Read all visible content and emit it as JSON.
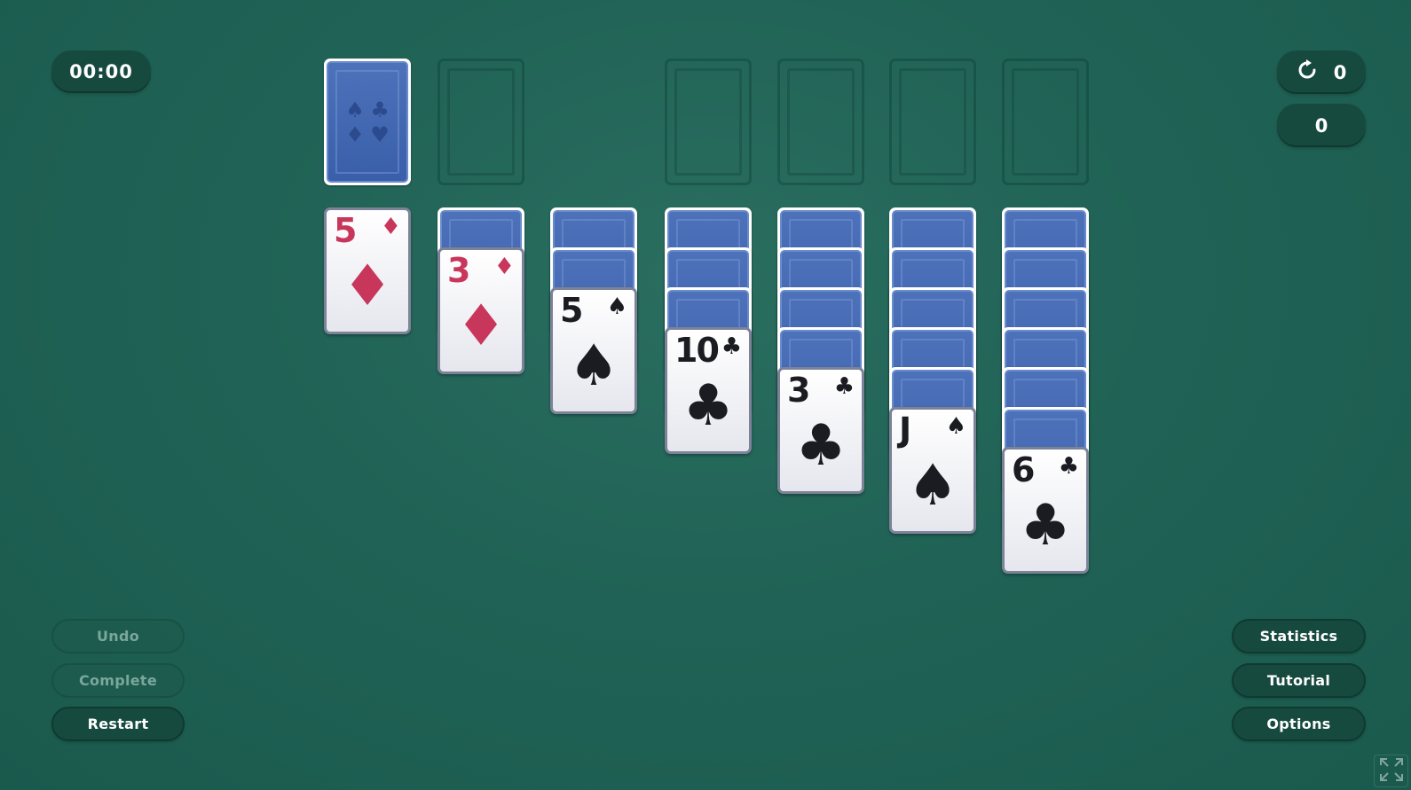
{
  "timer": {
    "value": "00:00"
  },
  "stats": {
    "moves": "0",
    "score": "0",
    "moves_icon": "restart-arrow-icon"
  },
  "stock": {
    "back_suits": [
      "♠",
      "♣",
      "♦",
      "♥"
    ]
  },
  "tableau": [
    {
      "hidden": 0,
      "face": {
        "rank": "5",
        "suit": "♦",
        "color": "red"
      }
    },
    {
      "hidden": 1,
      "face": {
        "rank": "3",
        "suit": "♦",
        "color": "red"
      }
    },
    {
      "hidden": 2,
      "face": {
        "rank": "5",
        "suit": "♠",
        "color": "black"
      }
    },
    {
      "hidden": 3,
      "face": {
        "rank": "10",
        "suit": "♣",
        "color": "black"
      }
    },
    {
      "hidden": 4,
      "face": {
        "rank": "3",
        "suit": "♣",
        "color": "black"
      }
    },
    {
      "hidden": 5,
      "face": {
        "rank": "J",
        "suit": "♠",
        "color": "black"
      }
    },
    {
      "hidden": 6,
      "face": {
        "rank": "6",
        "suit": "♣",
        "color": "black"
      }
    }
  ],
  "buttons": {
    "undo": "Undo",
    "complete": "Complete",
    "restart": "Restart",
    "statistics": "Statistics",
    "tutorial": "Tutorial",
    "options": "Options"
  },
  "icons": {
    "fullscreen": "fullscreen-icon"
  },
  "colors": {
    "felt": "#206356",
    "red_suit": "#c8375b",
    "black_suit": "#1b1c21",
    "card_back": "#3a5faa"
  }
}
